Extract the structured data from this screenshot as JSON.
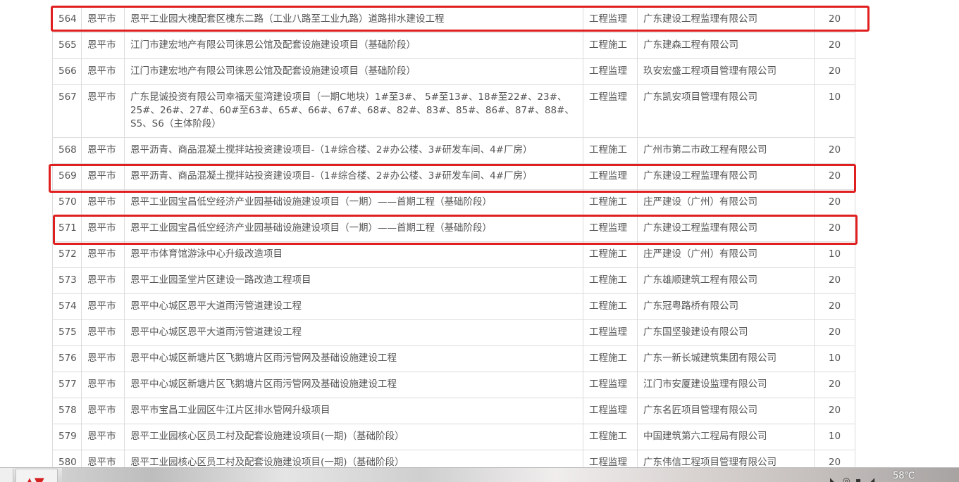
{
  "rows": [
    {
      "no": "564",
      "city": "恩平市",
      "name": "恩平工业园大槐配套区槐东二路（工业八路至工业九路）道路排水建设工程",
      "type": "工程监理",
      "company": "广东建设工程监理有限公司",
      "score": "20"
    },
    {
      "no": "565",
      "city": "恩平市",
      "name": "江门市建宏地产有限公司徕恩公馆及配套设施建设项目（基础阶段）",
      "type": "工程施工",
      "company": "广东建森工程有限公司",
      "score": "20"
    },
    {
      "no": "566",
      "city": "恩平市",
      "name": "江门市建宏地产有限公司徕恩公馆及配套设施建设项目（基础阶段）",
      "type": "工程监理",
      "company": "玖安宏盛工程项目管理有限公司",
      "score": "20"
    },
    {
      "no": "567",
      "city": "恩平市",
      "name": "广东昆诚投资有限公司幸福天玺湾建设项目（一期C地块）1#至3#、 5#至13#、18#至22#、23#、25#、26#、27#、60#至63#、65#、66#、67#、68#、82#、83#、85#、86#、87#、88#、S5、S6（主体阶段）",
      "type": "工程监理",
      "company": "广东凯安项目管理有限公司",
      "score": "10"
    },
    {
      "no": "568",
      "city": "恩平市",
      "name": "恩平沥青、商品混凝土搅拌站投资建设项目-（1#综合楼、2#办公楼、3#研发车间、4#厂房）",
      "type": "工程施工",
      "company": "广州市第二市政工程有限公司",
      "score": "20"
    },
    {
      "no": "569",
      "city": "恩平市",
      "name": "恩平沥青、商品混凝土搅拌站投资建设项目-（1#综合楼、2#办公楼、3#研发车间、4#厂房）",
      "type": "工程监理",
      "company": "广东建设工程监理有限公司",
      "score": "20"
    },
    {
      "no": "570",
      "city": "恩平市",
      "name": "恩平工业园宝昌低空经济产业园基础设施建设项目（一期）——首期工程（基础阶段）",
      "type": "工程施工",
      "company": "庄严建设（广州）有限公司",
      "score": "20"
    },
    {
      "no": "571",
      "city": "恩平市",
      "name": "恩平工业园宝昌低空经济产业园基础设施建设项目（一期）——首期工程（基础阶段）",
      "type": "工程监理",
      "company": "广东建设工程监理有限公司",
      "score": "20"
    },
    {
      "no": "572",
      "city": "恩平市",
      "name": "恩平市体育馆游泳中心升级改造项目",
      "type": "工程施工",
      "company": "庄严建设（广州）有限公司",
      "score": "10"
    },
    {
      "no": "573",
      "city": "恩平市",
      "name": "恩平工业园圣堂片区建设一路改造工程项目",
      "type": "工程施工",
      "company": "广东雄顺建筑工程有限公司",
      "score": "20"
    },
    {
      "no": "574",
      "city": "恩平市",
      "name": "恩平中心城区恩平大道雨污管道建设工程",
      "type": "工程施工",
      "company": "广东冠粤路桥有限公司",
      "score": "20"
    },
    {
      "no": "575",
      "city": "恩平市",
      "name": "恩平中心城区恩平大道雨污管道建设工程",
      "type": "工程监理",
      "company": "广东国坚骏建设有限公司",
      "score": "20"
    },
    {
      "no": "576",
      "city": "恩平市",
      "name": "恩平中心城区新塘片区飞鹅塘片区雨污管网及基础设施建设工程",
      "type": "工程施工",
      "company": "广东一新长城建筑集团有限公司",
      "score": "10"
    },
    {
      "no": "577",
      "city": "恩平市",
      "name": "恩平中心城区新塘片区飞鹅塘片区雨污管网及基础设施建设工程",
      "type": "工程监理",
      "company": "江门市安厦建设监理有限公司",
      "score": "20"
    },
    {
      "no": "578",
      "city": "恩平市",
      "name": "恩平市宝昌工业园区牛江片区排水管网升级项目",
      "type": "工程监理",
      "company": "广东名匠项目管理有限公司",
      "score": "20"
    },
    {
      "no": "579",
      "city": "恩平市",
      "name": "恩平工业园核心区员工村及配套设施建设项目(一期)（基础阶段）",
      "type": "工程施工",
      "company": "中国建筑第六工程局有限公司",
      "score": "10"
    },
    {
      "no": "580",
      "city": "恩平市",
      "name": "恩平工业园核心区员工村及配套设施建设项目(一期)（基础阶段）",
      "type": "工程监理",
      "company": "广东伟信工程项目管理有限公司",
      "score": "20"
    }
  ],
  "taskbar": {
    "temperature": "58℃"
  },
  "colors": {
    "highlight": "#e02020",
    "text": "#555555",
    "border": "#dcdcdc"
  }
}
